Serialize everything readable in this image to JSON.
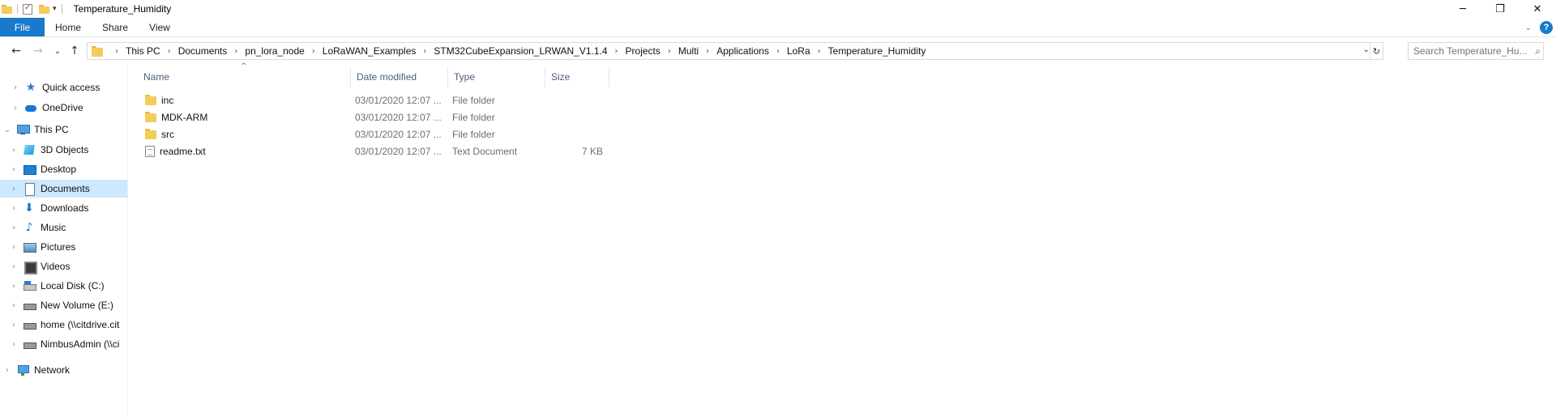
{
  "window": {
    "title": "Temperature_Humidity",
    "controls": {
      "minimize": "─",
      "restore": "❐",
      "close": "✕"
    }
  },
  "ribbon": {
    "tabs": [
      "File",
      "Home",
      "Share",
      "View"
    ],
    "expand_glyph": "⌄",
    "help_glyph": "?"
  },
  "address": {
    "back_glyph": "←",
    "forward_glyph": "→",
    "recent_glyph": "⌄",
    "up_glyph": "↑",
    "breadcrumbs": [
      "This PC",
      "Documents",
      "pn_lora_node",
      "LoRaWAN_Examples",
      "STM32CubeExpansion_LRWAN_V1.1.4",
      "Projects",
      "Multi",
      "Applications",
      "LoRa",
      "Temperature_Humidity"
    ],
    "separator_glyph": "›",
    "dropdown_glyph": "⌄",
    "refresh_glyph": "↻"
  },
  "search": {
    "placeholder": "Search Temperature_Hu...",
    "icon_glyph": "⌕"
  },
  "nav": {
    "items": [
      {
        "label": "Quick access",
        "icon": "star-icon",
        "glyph": "★"
      },
      {
        "label": "OneDrive",
        "icon": "cloud-icon"
      },
      {
        "label": "This PC",
        "icon": "computer-icon"
      },
      {
        "label": "3D Objects",
        "icon": "3d-objects-icon"
      },
      {
        "label": "Desktop",
        "icon": "desktop-icon"
      },
      {
        "label": "Documents",
        "icon": "documents-icon",
        "selected": true
      },
      {
        "label": "Downloads",
        "icon": "downloads-icon",
        "glyph": "⬇"
      },
      {
        "label": "Music",
        "icon": "music-icon",
        "glyph": "♪"
      },
      {
        "label": "Pictures",
        "icon": "pictures-icon"
      },
      {
        "label": "Videos",
        "icon": "videos-icon"
      },
      {
        "label": "Local Disk (C:)",
        "icon": "local-disk-icon"
      },
      {
        "label": "New Volume (E:)",
        "icon": "drive-icon"
      },
      {
        "label": "home (\\\\citdrive.cit",
        "icon": "network-drive-icon"
      },
      {
        "label": "NimbusAdmin (\\\\ci",
        "icon": "network-drive-icon"
      },
      {
        "label": "Network",
        "icon": "network-icon"
      }
    ],
    "collapsed_glyph": "›",
    "expanded_glyph": "⌄"
  },
  "filelist": {
    "columns": {
      "name": "Name",
      "date": "Date modified",
      "type": "Type",
      "size": "Size"
    },
    "sort_glyph": "^",
    "rows": [
      {
        "name": "inc",
        "date": "03/01/2020 12:07 ...",
        "type": "File folder",
        "size": "",
        "icon": "folder-icon"
      },
      {
        "name": "MDK-ARM",
        "date": "03/01/2020 12:07 ...",
        "type": "File folder",
        "size": "",
        "icon": "folder-icon"
      },
      {
        "name": "src",
        "date": "03/01/2020 12:07 ...",
        "type": "File folder",
        "size": "",
        "icon": "folder-icon"
      },
      {
        "name": "readme.txt",
        "date": "03/01/2020 12:07 ...",
        "type": "Text Document",
        "size": "7 KB",
        "icon": "text-file-icon"
      }
    ]
  },
  "colors": {
    "accent": "#1979ca",
    "selection": "#cce8ff",
    "header_text": "#4c607a",
    "folder": "#f5cc5a"
  }
}
